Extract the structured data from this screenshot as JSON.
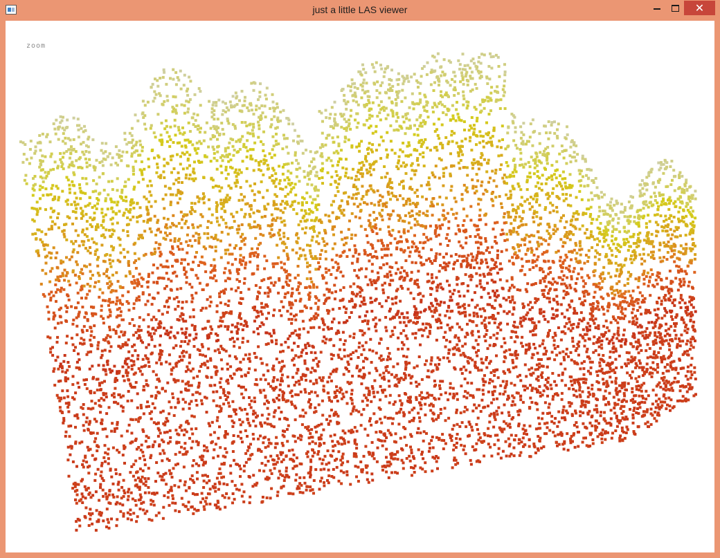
{
  "window": {
    "title": "just a little LAS viewer",
    "app_icon": "window-app-icon",
    "controls": {
      "minimize_icon": "minimize-icon",
      "maximize_icon": "maximize-icon",
      "close_icon": "close-icon",
      "close_glyph": "✕"
    },
    "frame_color": "#eb9673",
    "close_color": "#c7463a"
  },
  "viewer": {
    "mode_label": "zoom",
    "background": "#ffffff",
    "point_colors": {
      "ground": "#c9381a",
      "mid": "#e0661e",
      "vegetation": "#d4cd1c",
      "canopy_top": "#cfcfa8"
    }
  }
}
